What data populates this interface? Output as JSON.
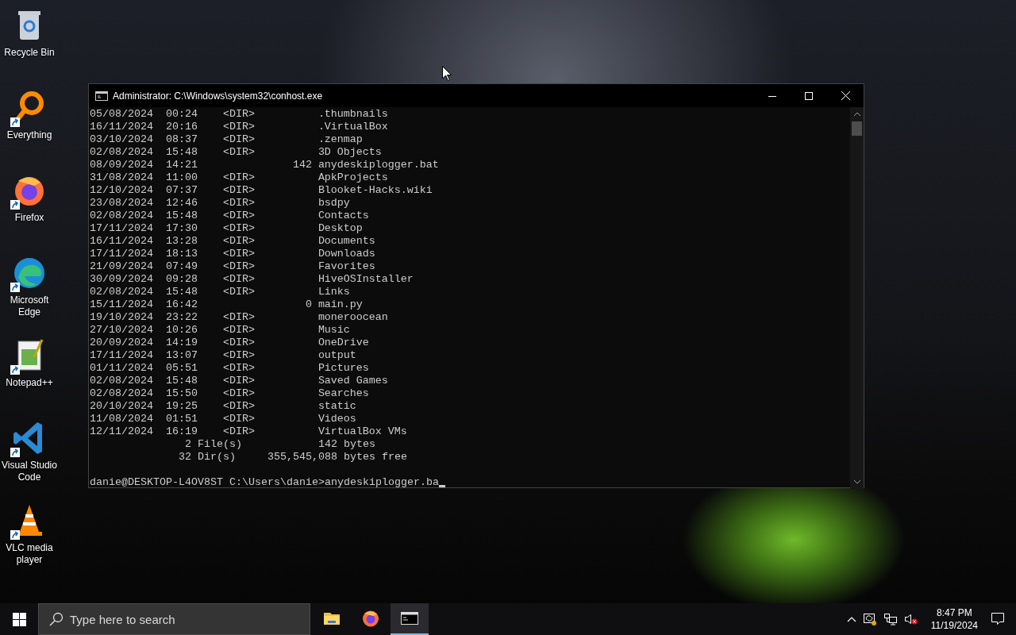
{
  "desktop_icons": [
    {
      "label": "Recycle Bin",
      "kind": "bin",
      "shortcut": false
    },
    {
      "label": "Everything",
      "kind": "magnifier",
      "shortcut": true
    },
    {
      "label": "Firefox",
      "kind": "fox",
      "shortcut": true
    },
    {
      "label": "Microsoft Edge",
      "kind": "wave",
      "shortcut": true
    },
    {
      "label": "Notepad++",
      "kind": "notepad",
      "shortcut": true
    },
    {
      "label": "Visual Studio Code",
      "kind": "code",
      "shortcut": true
    },
    {
      "label": "VLC media player",
      "kind": "cone",
      "shortcut": true
    }
  ],
  "window": {
    "title": "Administrator: C:\\Windows\\system32\\conhost.exe",
    "listing": [
      {
        "date": "05/08/2024",
        "time": "00:24",
        "type": "<DIR>",
        "name": ".thumbnails"
      },
      {
        "date": "16/11/2024",
        "time": "20:16",
        "type": "<DIR>",
        "name": ".VirtualBox"
      },
      {
        "date": "03/10/2024",
        "time": "08:37",
        "type": "<DIR>",
        "name": ".zenmap"
      },
      {
        "date": "02/08/2024",
        "time": "15:48",
        "type": "<DIR>",
        "name": "3D Objects"
      },
      {
        "date": "08/09/2024",
        "time": "14:21",
        "size": "142",
        "name": "anydeskiplogger.bat"
      },
      {
        "date": "31/08/2024",
        "time": "11:00",
        "type": "<DIR>",
        "name": "ApkProjects"
      },
      {
        "date": "12/10/2024",
        "time": "07:37",
        "type": "<DIR>",
        "name": "Blooket-Hacks.wiki"
      },
      {
        "date": "23/08/2024",
        "time": "12:46",
        "type": "<DIR>",
        "name": "bsdpy"
      },
      {
        "date": "02/08/2024",
        "time": "15:48",
        "type": "<DIR>",
        "name": "Contacts"
      },
      {
        "date": "17/11/2024",
        "time": "17:30",
        "type": "<DIR>",
        "name": "Desktop"
      },
      {
        "date": "16/11/2024",
        "time": "13:28",
        "type": "<DIR>",
        "name": "Documents"
      },
      {
        "date": "17/11/2024",
        "time": "18:13",
        "type": "<DIR>",
        "name": "Downloads"
      },
      {
        "date": "21/09/2024",
        "time": "07:49",
        "type": "<DIR>",
        "name": "Favorites"
      },
      {
        "date": "30/09/2024",
        "time": "09:28",
        "type": "<DIR>",
        "name": "HiveOSInstaller"
      },
      {
        "date": "02/08/2024",
        "time": "15:48",
        "type": "<DIR>",
        "name": "Links"
      },
      {
        "date": "15/11/2024",
        "time": "16:42",
        "size": "0",
        "name": "main.py"
      },
      {
        "date": "19/10/2024",
        "time": "23:22",
        "type": "<DIR>",
        "name": "moneroocean"
      },
      {
        "date": "27/10/2024",
        "time": "10:26",
        "type": "<DIR>",
        "name": "Music"
      },
      {
        "date": "20/09/2024",
        "time": "14:19",
        "type": "<DIR>",
        "name": "OneDrive"
      },
      {
        "date": "17/11/2024",
        "time": "13:07",
        "type": "<DIR>",
        "name": "output"
      },
      {
        "date": "01/11/2024",
        "time": "05:51",
        "type": "<DIR>",
        "name": "Pictures"
      },
      {
        "date": "02/08/2024",
        "time": "15:48",
        "type": "<DIR>",
        "name": "Saved Games"
      },
      {
        "date": "02/08/2024",
        "time": "15:50",
        "type": "<DIR>",
        "name": "Searches"
      },
      {
        "date": "20/10/2024",
        "time": "19:25",
        "type": "<DIR>",
        "name": "static"
      },
      {
        "date": "11/08/2024",
        "time": "01:51",
        "type": "<DIR>",
        "name": "Videos"
      },
      {
        "date": "12/11/2024",
        "time": "16:19",
        "type": "<DIR>",
        "name": "VirtualBox VMs"
      }
    ],
    "summary": [
      {
        "count": "2",
        "label": "File(s)",
        "amount": "142",
        "unit": "bytes"
      },
      {
        "count": "32",
        "label": "Dir(s)",
        "amount": "355,545,088",
        "unit": "bytes free"
      }
    ],
    "prompt": "danie@DESKTOP-L4OV8ST C:\\Users\\danie>",
    "command": "anydeskiplogger.ba"
  },
  "taskbar": {
    "search": {
      "placeholder": "Type here to search"
    },
    "apps": [
      {
        "kind": "folder",
        "selected": false
      },
      {
        "kind": "fox",
        "selected": false
      },
      {
        "kind": "console",
        "selected": true
      }
    ],
    "time": "8:47 PM",
    "date": "11/19/2024"
  }
}
